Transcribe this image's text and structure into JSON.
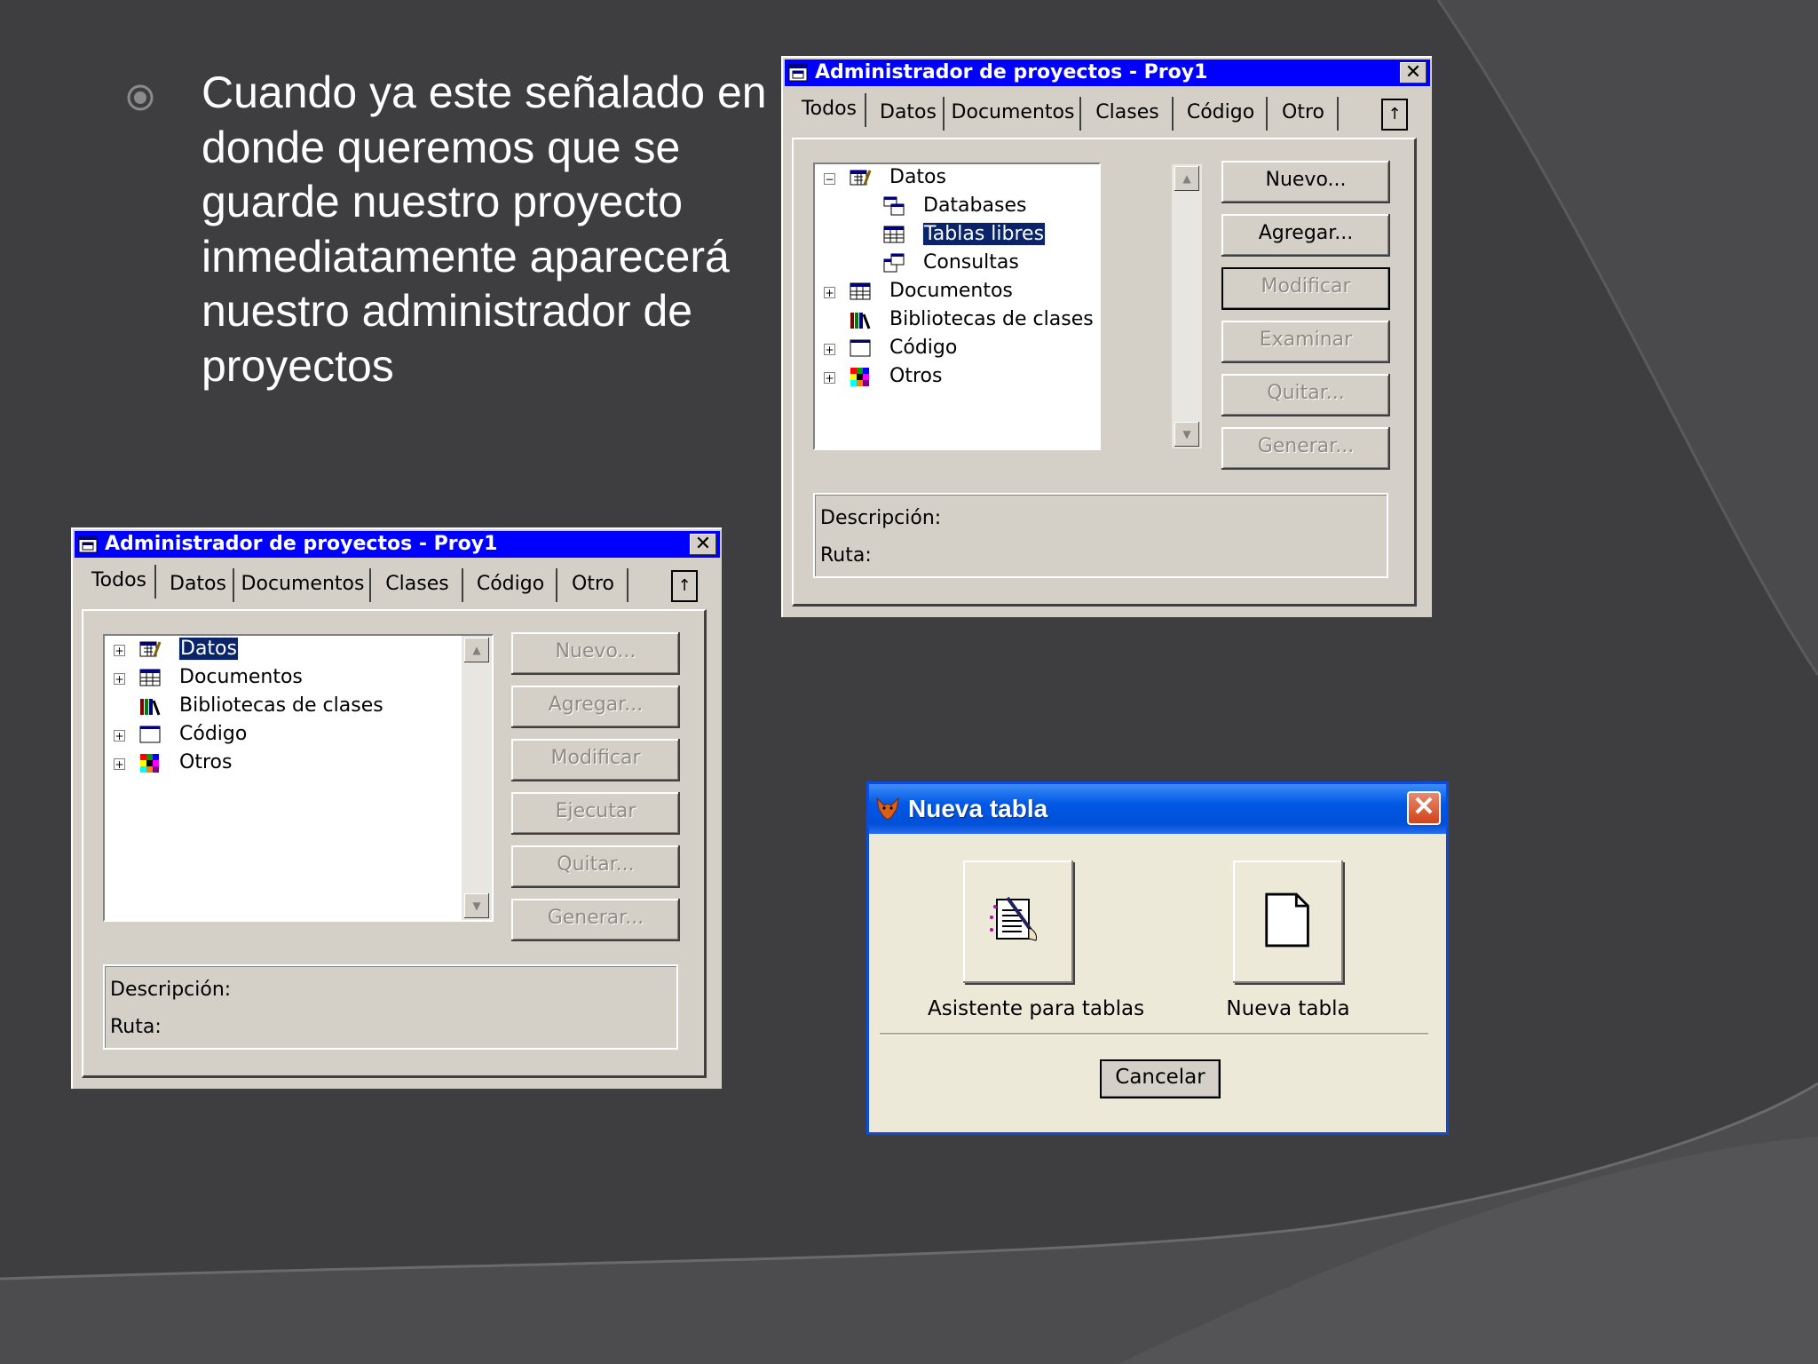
{
  "slide": {
    "text_lines": [
      "Cuando ya este señalado en",
      "donde queremos que se",
      "guarde nuestro proyecto",
      "inmediatamente aparecerá",
      "nuestro administrador de",
      "proyectos"
    ]
  },
  "project_manager_large": {
    "title": "Administrador de proyectos - Proy1",
    "close": "✕",
    "tabs": [
      "Todos",
      "Datos",
      "Documentos",
      "Clases",
      "Código",
      "Otro"
    ],
    "tab_arrow": "↑",
    "tree": [
      "Datos",
      "Databases",
      "Tablas libres",
      "Consultas",
      "Documentos",
      "Bibliotecas de clases",
      "Código",
      "Otros"
    ],
    "expanders": [
      "−",
      "+",
      "+",
      "+"
    ],
    "buttons": [
      "Nuevo...",
      "Agregar...",
      "Modificar",
      "Examinar",
      "Quitar...",
      "Generar..."
    ],
    "description_label": "Descripción:",
    "path_label": "Ruta:"
  },
  "project_manager_small": {
    "title": "Administrador de proyectos - Proy1",
    "close": "✕",
    "tabs": [
      "Todos",
      "Datos",
      "Documentos",
      "Clases",
      "Código",
      "Otro"
    ],
    "tab_arrow": "↑",
    "tree": [
      "Datos",
      "Documentos",
      "Bibliotecas de clases",
      "Código",
      "Otros"
    ],
    "expanders": [
      "+",
      "+",
      "+",
      "+"
    ],
    "buttons": [
      "Nuevo...",
      "Agregar...",
      "Modificar",
      "Ejecutar",
      "Quitar...",
      "Generar..."
    ],
    "description_label": "Descripción:",
    "path_label": "Ruta:"
  },
  "new_table_dialog": {
    "title": "Nueva tabla",
    "close": "✕",
    "wizard_label": "Asistente para tablas",
    "new_table_label": "Nueva tabla",
    "cancel": "Cancelar"
  },
  "colors": {
    "background": "#3e3e40",
    "classic_titlebar": "#0000ff",
    "selection": "#0a246a",
    "window_face": "#d4d0c8",
    "xp_face": "#ece9d8"
  }
}
